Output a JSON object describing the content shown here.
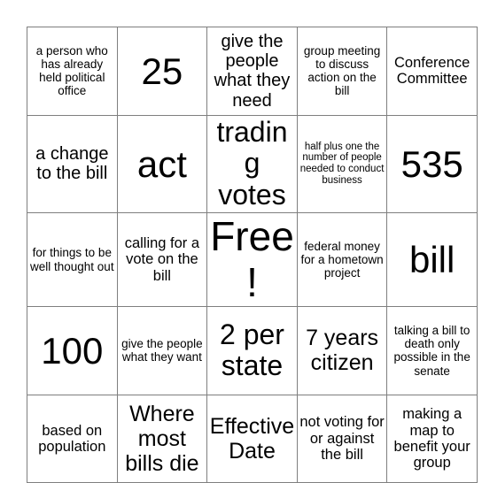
{
  "card": {
    "type": "bingo-card",
    "columns": 5,
    "rows": 5,
    "background_color": "#ffffff",
    "border_color": "#7f7f7f",
    "text_color": "#000000",
    "free_space": {
      "row": 3,
      "column": 3,
      "label": "Free!"
    },
    "cells": [
      [
        {
          "text": "a person who has already held political office",
          "size": "sz-sm"
        },
        {
          "text": "25",
          "size": "sz-huge"
        },
        {
          "text": "give the people what they need",
          "size": "sz-lg"
        },
        {
          "text": "group meeting to discuss action on the bill",
          "size": "sz-sm"
        },
        {
          "text": "Conference Committee",
          "size": "sz-md"
        }
      ],
      [
        {
          "text": "a change to the bill",
          "size": "sz-lg"
        },
        {
          "text": "act",
          "size": "sz-huge"
        },
        {
          "text": "trading votes",
          "size": "sz-xxl"
        },
        {
          "text": "half plus one the number of people needed to conduct business",
          "size": "sz-xs"
        },
        {
          "text": "535",
          "size": "sz-huge"
        }
      ],
      [
        {
          "text": "for things to be well thought out",
          "size": "sz-sm"
        },
        {
          "text": "calling for a vote on the bill",
          "size": "sz-md"
        },
        {
          "text": "Free!",
          "size": "sz-mega"
        },
        {
          "text": "federal money for a hometown project",
          "size": "sz-sm"
        },
        {
          "text": "bill",
          "size": "sz-huge"
        }
      ],
      [
        {
          "text": "100",
          "size": "sz-huge"
        },
        {
          "text": "give the people what they want",
          "size": "sz-sm"
        },
        {
          "text": "2 per state",
          "size": "sz-xxl"
        },
        {
          "text": "7 years citizen",
          "size": "sz-xl"
        },
        {
          "text": "talking a bill to death only possible in the senate",
          "size": "sz-sm"
        }
      ],
      [
        {
          "text": "based on population",
          "size": "sz-md"
        },
        {
          "text": "Where most bills die",
          "size": "sz-xl"
        },
        {
          "text": "Effective Date",
          "size": "sz-xl"
        },
        {
          "text": "not voting for or against the bill",
          "size": "sz-md"
        },
        {
          "text": "making a map to benefit your group",
          "size": "sz-md"
        }
      ]
    ]
  }
}
